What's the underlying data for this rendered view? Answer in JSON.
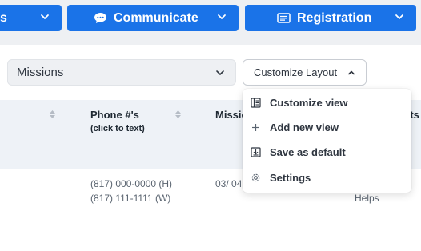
{
  "nav": {
    "first_fragment": "s",
    "communicate": "Communicate",
    "registration": "Registration"
  },
  "filter": {
    "select_value": "Missions",
    "customize_label": "Customize Layout"
  },
  "table": {
    "headers": {
      "phone": "Phone #'s",
      "phone_sub": "(click to text)",
      "missions": "Missio",
      "shifts": "fts"
    },
    "row": {
      "phone_1": "(817) 000-0000 (H)",
      "phone_2": "(817) 111-1111 (W)",
      "date": "03/ 04",
      "helps": "Helps"
    }
  },
  "menu": {
    "items": [
      {
        "label": "Customize view",
        "icon": "layout-icon"
      },
      {
        "label": "Add new view",
        "icon": "plus-icon"
      },
      {
        "label": "Save as default",
        "icon": "save-icon"
      },
      {
        "label": "Settings",
        "icon": "gear-icon"
      }
    ]
  },
  "colors": {
    "primary": "#1a73e8",
    "header_bg": "#eef2f7",
    "text": "#2f3640"
  }
}
